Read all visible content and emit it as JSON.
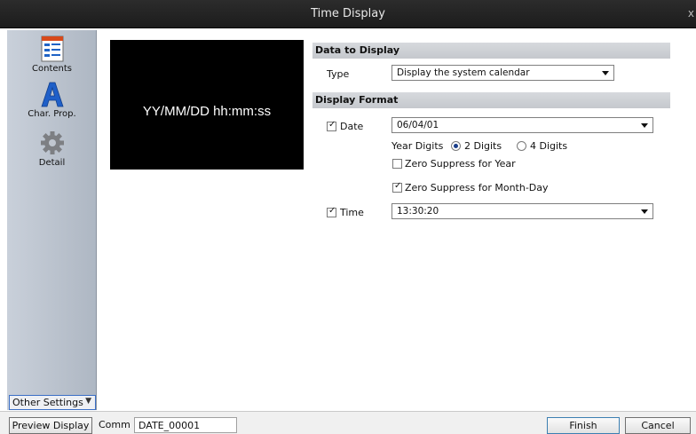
{
  "window": {
    "title": "Time Display",
    "close_glyph": "x"
  },
  "sidebar": {
    "items": [
      {
        "label": "Contents",
        "icon": "contents-icon"
      },
      {
        "label": "Char. Prop.",
        "icon": "char-prop-icon"
      },
      {
        "label": "Detail",
        "icon": "gear-icon"
      }
    ],
    "other_settings": "Other Settings"
  },
  "preview": {
    "format_text": "YY/MM/DD hh:mm:ss"
  },
  "data_to_display": {
    "heading": "Data to Display",
    "type_label": "Type",
    "type_value": "Display the system calendar"
  },
  "display_format": {
    "heading": "Display Format",
    "date_label": "Date",
    "date_checked": true,
    "date_value": "06/04/01",
    "year_digits_label": "Year Digits",
    "year_option_2": "2 Digits",
    "year_option_4": "4 Digits",
    "year_selected": "2 Digits",
    "zero_suppress_year": "Zero Suppress for Year",
    "zero_suppress_year_checked": false,
    "zero_suppress_month_day": "Zero Suppress for Month-Day",
    "zero_suppress_month_day_checked": true,
    "time_label": "Time",
    "time_checked": true,
    "time_value": "13:30:20"
  },
  "footer": {
    "preview_button": "Preview Display",
    "comm_label": "Comm",
    "comm_value": "DATE_00001",
    "finish_button": "Finish",
    "cancel_button": "Cancel"
  }
}
